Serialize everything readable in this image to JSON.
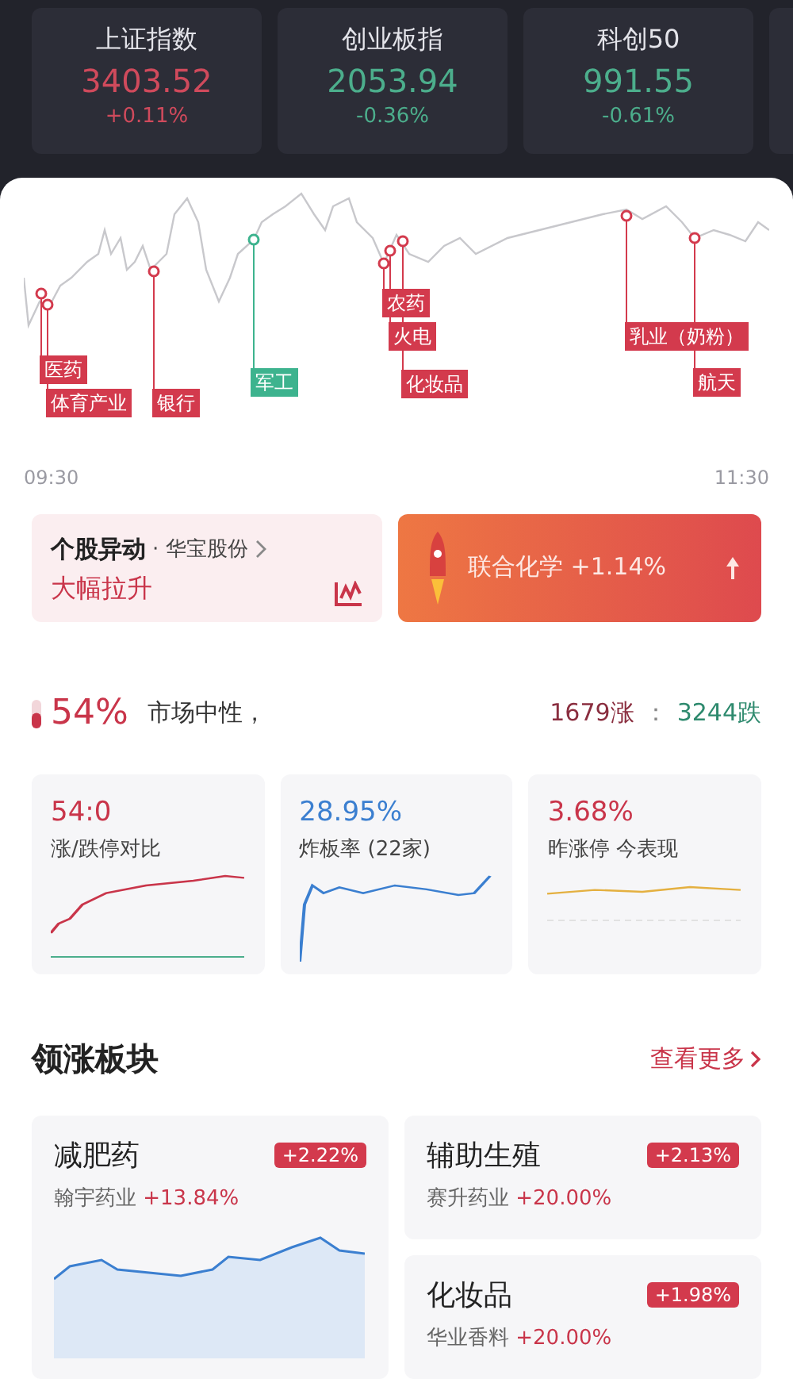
{
  "indices": [
    {
      "name": "上证指数",
      "value": "3403.52",
      "change": "+0.11%",
      "color": "#d04a5c"
    },
    {
      "name": "创业板指",
      "value": "2053.94",
      "change": "-0.36%",
      "color": "#4cae8c"
    },
    {
      "name": "科创50",
      "value": "991.55",
      "change": "-0.61%",
      "color": "#4cae8c"
    }
  ],
  "intraday": {
    "start_time": "09:30",
    "end_time": "11:30",
    "events": [
      {
        "label": "医药",
        "color": "#d33a4d"
      },
      {
        "label": "体育产业",
        "color": "#d33a4d"
      },
      {
        "label": "银行",
        "color": "#d33a4d"
      },
      {
        "label": "军工",
        "color": "#3db38e"
      },
      {
        "label": "农药",
        "color": "#d33a4d"
      },
      {
        "label": "火电",
        "color": "#d33a4d"
      },
      {
        "label": "化妆品",
        "color": "#d33a4d"
      },
      {
        "label": "乳业（奶粉）",
        "color": "#d33a4d"
      },
      {
        "label": "航天",
        "color": "#d33a4d"
      }
    ]
  },
  "alerts": {
    "stock_move": {
      "title": "个股异动",
      "stock": "· 华宝股份",
      "action": "大幅拉升"
    },
    "rocket": {
      "text": "联合化学 +1.14%"
    }
  },
  "market": {
    "percent": "54%",
    "mood": "市场中性，",
    "up_count": "1679涨",
    "separator": "：",
    "down_count": "3244跌",
    "level": 0.54
  },
  "stats": [
    {
      "value": "54:0",
      "label": "涨/跌停对比",
      "kind": "ratio"
    },
    {
      "value": "28.95%",
      "label": "炸板率 (22家)",
      "kind": "blowup"
    },
    {
      "value": "3.68%",
      "label": "昨涨停 今表现",
      "kind": "yesterday"
    }
  ],
  "sectors": {
    "title": "领涨板块",
    "more": "查看更多",
    "items": [
      {
        "name": "减肥药",
        "change": "+2.22%",
        "leader": "翰宇药业",
        "leader_change": "+13.84%"
      },
      {
        "name": "辅助生殖",
        "change": "+2.13%",
        "leader": "赛升药业",
        "leader_change": "+20.00%"
      },
      {
        "name": "化妆品",
        "change": "+1.98%",
        "leader": "华业香料",
        "leader_change": "+20.00%"
      }
    ]
  }
}
